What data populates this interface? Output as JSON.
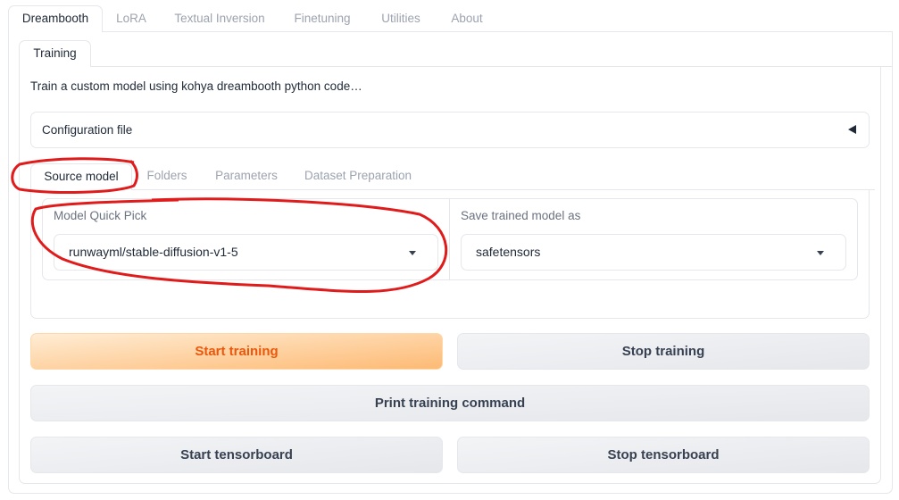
{
  "top_tabs": [
    {
      "label": "Dreambooth",
      "active": true
    },
    {
      "label": "LoRA"
    },
    {
      "label": "Textual Inversion"
    },
    {
      "label": "Finetuning"
    },
    {
      "label": "Utilities"
    },
    {
      "label": "About"
    }
  ],
  "sub_tab": "Training",
  "description": "Train a custom model using kohya dreambooth python code…",
  "config_accordion": {
    "label": "Configuration file",
    "icon": "triangle-left-icon"
  },
  "section_tabs": [
    {
      "label": "Source model",
      "active": true
    },
    {
      "label": "Folders"
    },
    {
      "label": "Parameters"
    },
    {
      "label": "Dataset Preparation"
    }
  ],
  "model_quick_pick": {
    "label": "Model Quick Pick",
    "value": "runwayml/stable-diffusion-v1-5"
  },
  "save_model_as": {
    "label": "Save trained model as",
    "value": "safetensors"
  },
  "buttons": {
    "start_training": "Start training",
    "stop_training": "Stop training",
    "print_command": "Print training command",
    "start_tensorboard": "Start tensorboard",
    "stop_tensorboard": "Stop tensorboard"
  },
  "annotation_color": "#e01b1b"
}
